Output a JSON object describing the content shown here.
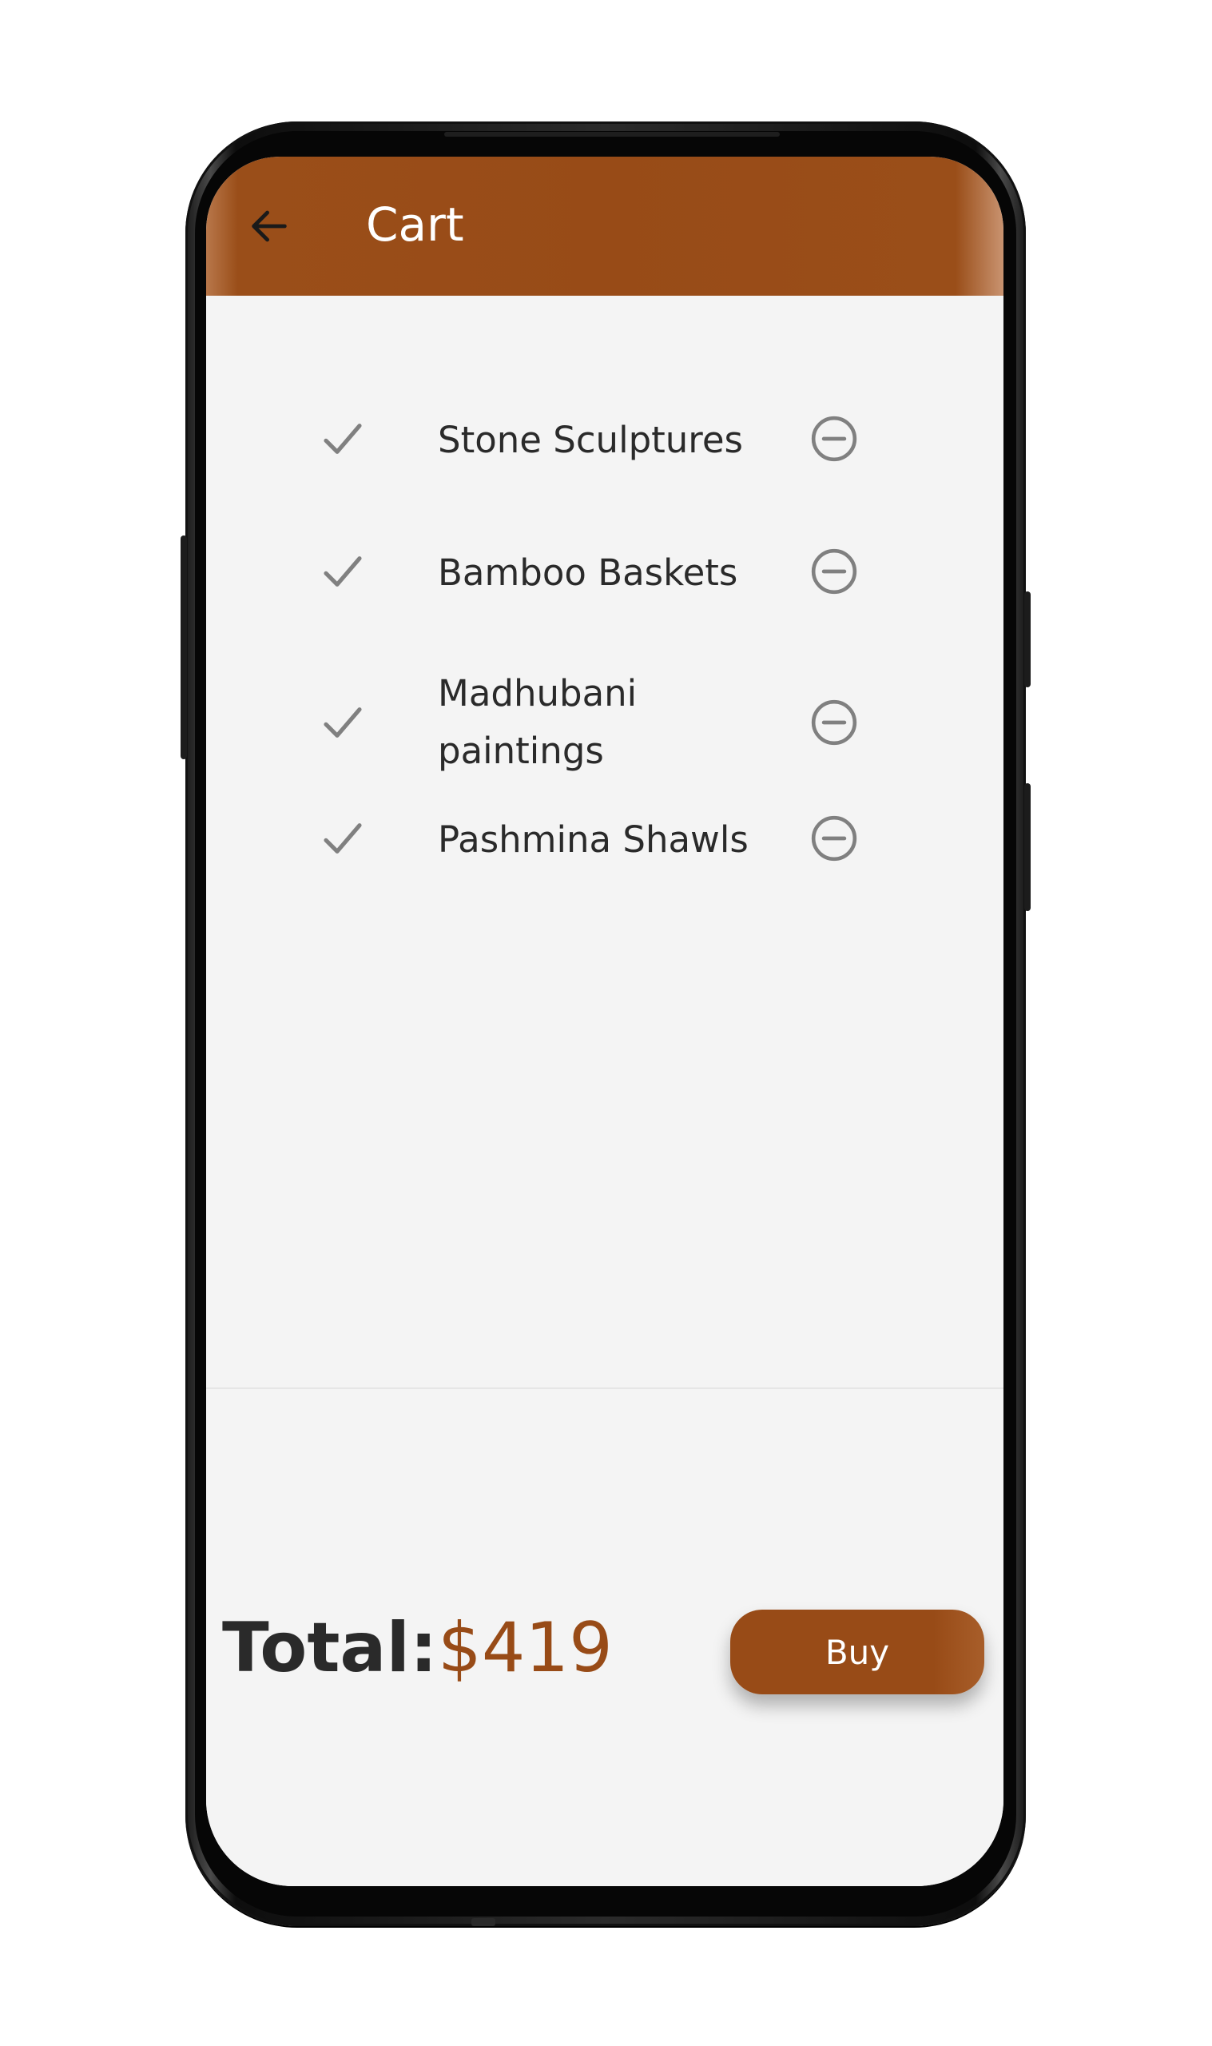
{
  "app_bar": {
    "title": "Cart",
    "back_icon": "arrow-left-icon",
    "color": "#984b17"
  },
  "cart": {
    "items": [
      {
        "name": "Stone Sculptures",
        "status_icon": "checkmark-icon",
        "action_icon": "minus-circle-icon"
      },
      {
        "name": "Bamboo Baskets",
        "status_icon": "checkmark-icon",
        "action_icon": "minus-circle-icon"
      },
      {
        "name": "Madhubani paintings",
        "status_icon": "checkmark-icon",
        "action_icon": "minus-circle-icon"
      },
      {
        "name": "Pashmina Shawls",
        "status_icon": "checkmark-icon",
        "action_icon": "minus-circle-icon"
      }
    ]
  },
  "summary": {
    "total_label": "Total:",
    "total_value": "$419",
    "buy_label": "Buy"
  },
  "colors": {
    "accent": "#984b17",
    "background": "#f4f4f4",
    "text": "#2a2a2a",
    "icon": "#808080"
  }
}
